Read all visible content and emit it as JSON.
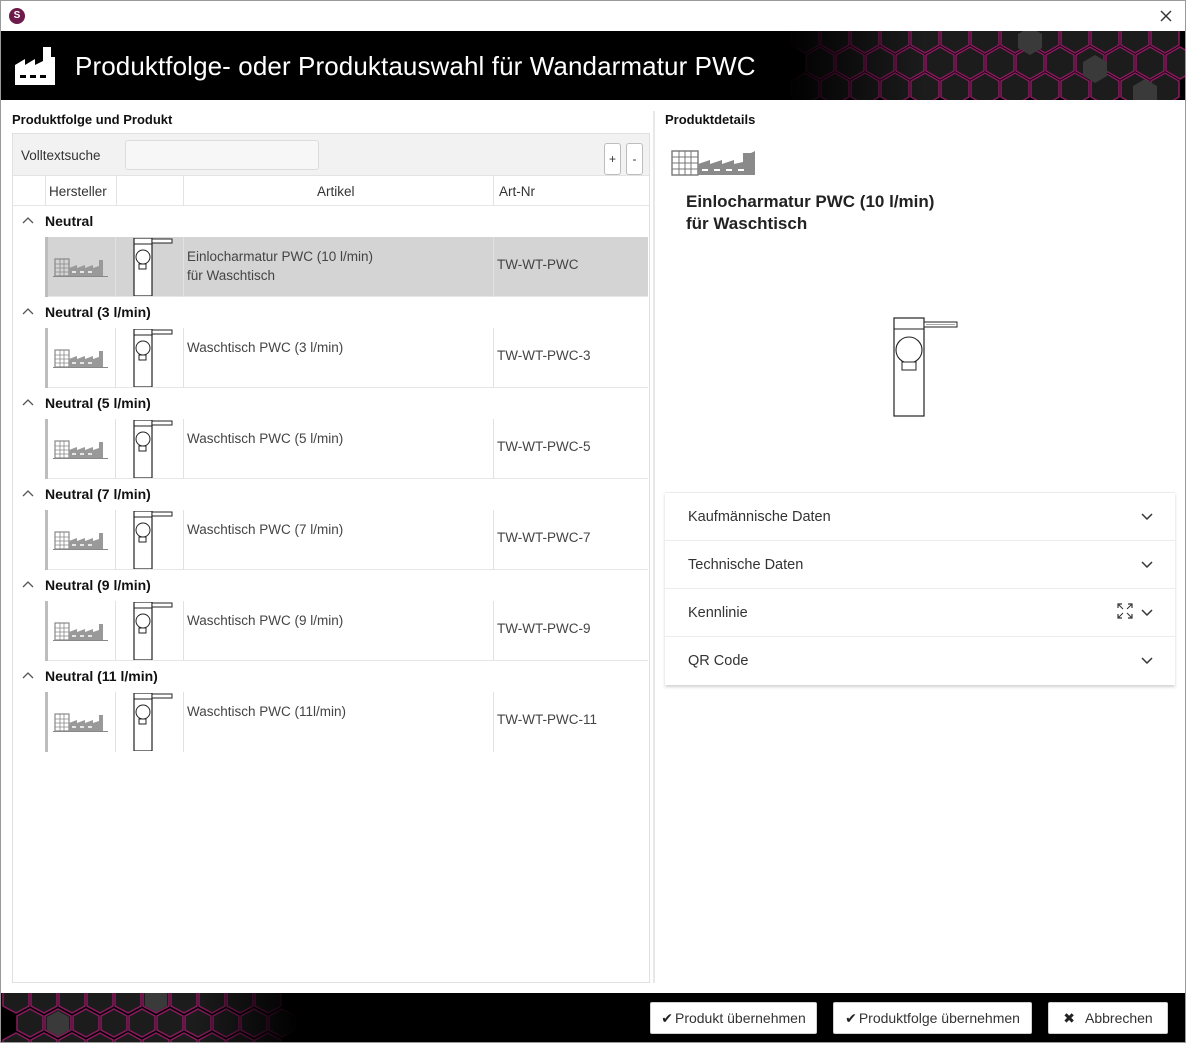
{
  "window": {
    "app_icon_letter": "S",
    "banner_title": "Produktfolge- oder Produktauswahl für Wandarmatur PWC"
  },
  "left": {
    "section_label": "Produktfolge und Produkt",
    "search_label": "Volltextsuche",
    "search_value": "",
    "plus_label": "+",
    "minus_label": "-",
    "columns": {
      "hersteller": "Hersteller",
      "artikel": "Artikel",
      "artnr": "Art-Nr"
    },
    "groups": [
      {
        "title": "Neutral",
        "artikel_line1": "Einlocharmatur PWC (10 l/min)",
        "artikel_line2": "für Waschtisch",
        "artnr": "TW-WT-PWC",
        "selected": true
      },
      {
        "title": "Neutral (3 l/min)",
        "artikel_line1": "Waschtisch PWC (3 l/min)",
        "artikel_line2": "",
        "artnr": "TW-WT-PWC-3",
        "selected": false
      },
      {
        "title": "Neutral (5 l/min)",
        "artikel_line1": "Waschtisch PWC (5 l/min)",
        "artikel_line2": "",
        "artnr": "TW-WT-PWC-5",
        "selected": false
      },
      {
        "title": "Neutral (7 l/min)",
        "artikel_line1": "Waschtisch PWC (7 l/min)",
        "artikel_line2": "",
        "artnr": "TW-WT-PWC-7",
        "selected": false
      },
      {
        "title": "Neutral (9 l/min)",
        "artikel_line1": "Waschtisch PWC (9 l/min)",
        "artikel_line2": "",
        "artnr": "TW-WT-PWC-9",
        "selected": false
      },
      {
        "title": "Neutral (11 l/min)",
        "artikel_line1": "Waschtisch PWC (11l/min)",
        "artikel_line2": "",
        "artnr": "TW-WT-PWC-11",
        "selected": false
      }
    ]
  },
  "right": {
    "section_label": "Produktdetails",
    "product_name_line1": "Einlocharmatur PWC (10 l/min)",
    "product_name_line2": "für Waschtisch",
    "accordion": [
      {
        "label": "Kaufmännische Daten"
      },
      {
        "label": "Technische Daten"
      },
      {
        "label": "Kennlinie"
      },
      {
        "label": "QR Code"
      }
    ]
  },
  "footer": {
    "btn_produkt": "Produkt übernehmen",
    "btn_produktfolge": "Produktfolge übernehmen",
    "btn_abbrechen": "Abbrechen"
  },
  "colors": {
    "banner_bg": "#000000",
    "accent_magenta": "#b0207a",
    "selected_row": "#d4d4d4"
  },
  "icons": {
    "app": "app-logo-icon",
    "close": "close-icon",
    "banner": "factory-icon",
    "manufacturer": "manufacturer-factory-icon",
    "product": "faucet-icon",
    "collapse": "chevron-up-icon",
    "expand": "chevron-down-icon",
    "fullscreen": "fullscreen-icon",
    "check": "check-icon",
    "cancel": "cross-icon"
  }
}
